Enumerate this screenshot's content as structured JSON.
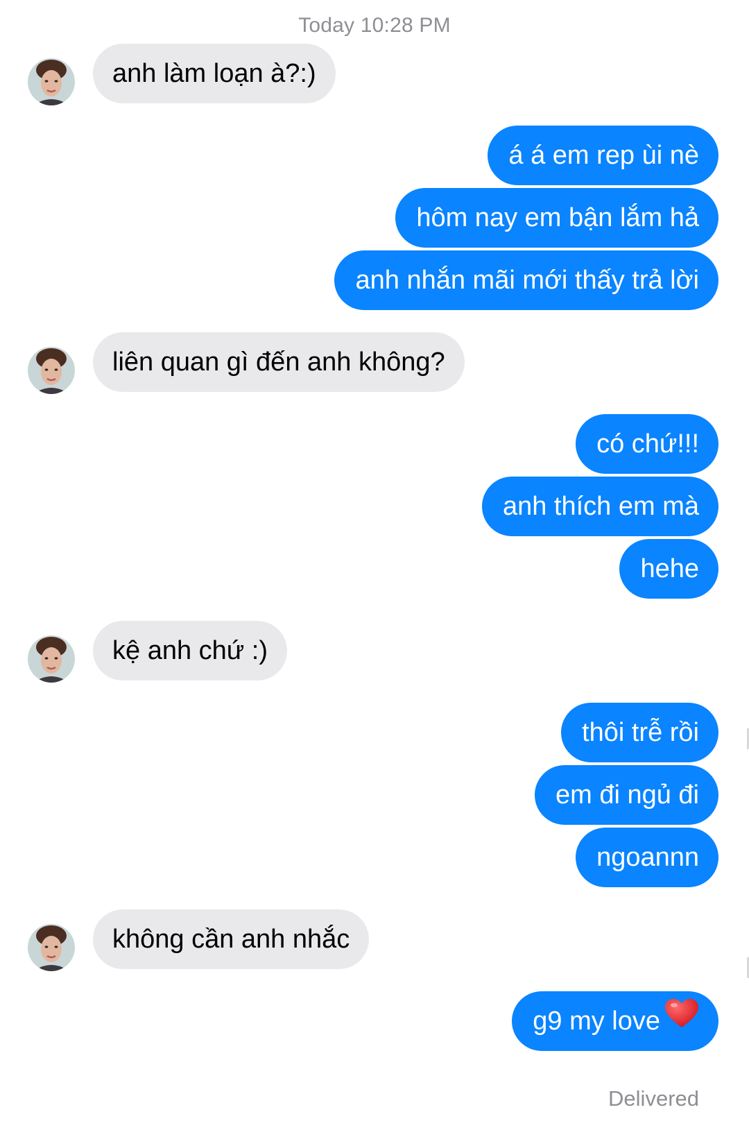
{
  "chat": {
    "timestamp": "Today 10:28 PM",
    "status": "Delivered",
    "contact_avatar_icon": "contact-avatar-photo",
    "incoming_color": "#e9e9eb",
    "outgoing_color": "#0a84ff",
    "messages": [
      {
        "sender": "contact",
        "text": "anh làm loạn à?:)"
      },
      {
        "sender": "me",
        "text": "á á em rep ùi nè"
      },
      {
        "sender": "me",
        "text": "hôm nay em bận lắm hả"
      },
      {
        "sender": "me",
        "text": "anh nhắn mãi mới thấy trả lời"
      },
      {
        "sender": "contact",
        "text": "liên quan gì đến anh không?"
      },
      {
        "sender": "me",
        "text": "có chứ!!!"
      },
      {
        "sender": "me",
        "text": "anh thích em mà"
      },
      {
        "sender": "me",
        "text": "hehe"
      },
      {
        "sender": "contact",
        "text": "kệ anh chứ :)"
      },
      {
        "sender": "me",
        "text": "thôi trễ rồi"
      },
      {
        "sender": "me",
        "text": "em đi ngủ đi"
      },
      {
        "sender": "me",
        "text": "ngoannn"
      },
      {
        "sender": "contact",
        "text": "không cần anh nhắc"
      },
      {
        "sender": "me",
        "text": "g9 my love",
        "emoji": "heart-icon"
      }
    ]
  }
}
